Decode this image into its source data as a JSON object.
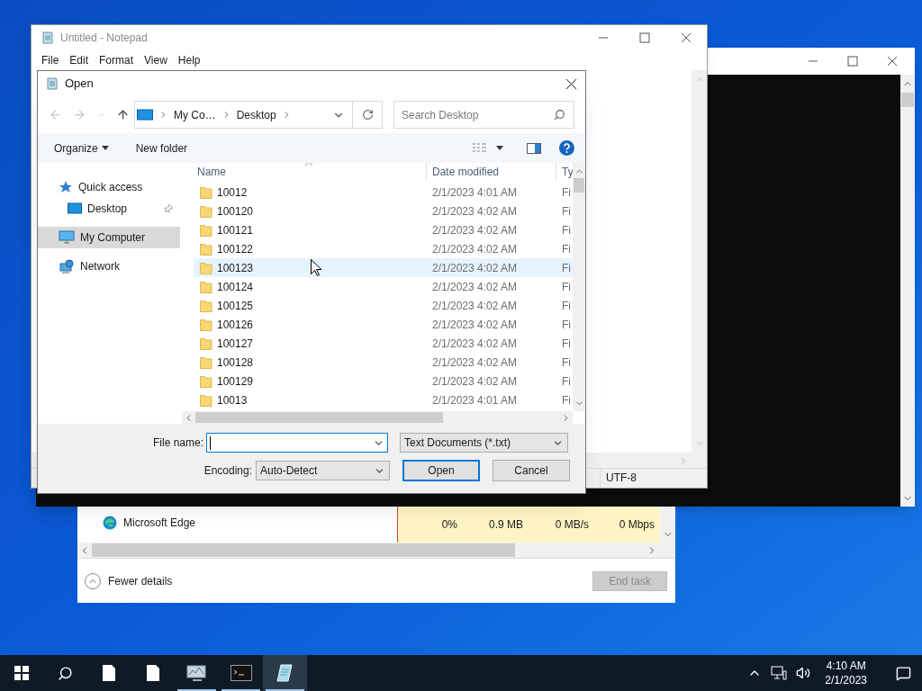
{
  "task_manager": {
    "process": {
      "name": "Microsoft Edge",
      "cells": [
        "0%",
        "0.9 MB",
        "0 MB/s",
        "0 Mbps"
      ]
    },
    "details_toggle": "Fewer details",
    "end_task": {
      "label": "End task",
      "disabled": true
    }
  },
  "notepad": {
    "title": "Untitled - Notepad",
    "menu": [
      "File",
      "Edit",
      "Format",
      "View",
      "Help"
    ],
    "status_bar": [
      "UTF-8"
    ]
  },
  "open_dialog": {
    "title": "Open",
    "breadcrumb": [
      "My Co…",
      "Desktop"
    ],
    "search": {
      "placeholder": "Search Desktop"
    },
    "toolbar": [
      "Organize",
      "New folder"
    ],
    "nav": [
      {
        "label": "Quick access",
        "kind": "star",
        "selected": false,
        "children": [
          {
            "label": "Desktop",
            "kind": "desktop",
            "selected": false,
            "pinned": true
          }
        ]
      },
      {
        "label": "My Computer",
        "kind": "computer",
        "selected": true
      },
      {
        "label": "Network",
        "kind": "network",
        "selected": false
      }
    ],
    "columns": [
      "Name",
      "Date modified",
      "Ty"
    ],
    "rows": [
      {
        "name": "10012",
        "date": "2/1/2023 4:01 AM",
        "type": "Fi",
        "hovered": false
      },
      {
        "name": "100120",
        "date": "2/1/2023 4:02 AM",
        "type": "Fi",
        "hovered": false
      },
      {
        "name": "100121",
        "date": "2/1/2023 4:02 AM",
        "type": "Fi",
        "hovered": false
      },
      {
        "name": "100122",
        "date": "2/1/2023 4:02 AM",
        "type": "Fi",
        "hovered": false
      },
      {
        "name": "100123",
        "date": "2/1/2023 4:02 AM",
        "type": "Fi",
        "hovered": true
      },
      {
        "name": "100124",
        "date": "2/1/2023 4:02 AM",
        "type": "Fi",
        "hovered": false
      },
      {
        "name": "100125",
        "date": "2/1/2023 4:02 AM",
        "type": "Fi",
        "hovered": false
      },
      {
        "name": "100126",
        "date": "2/1/2023 4:02 AM",
        "type": "Fi",
        "hovered": false
      },
      {
        "name": "100127",
        "date": "2/1/2023 4:02 AM",
        "type": "Fi",
        "hovered": false
      },
      {
        "name": "100128",
        "date": "2/1/2023 4:02 AM",
        "type": "Fi",
        "hovered": false
      },
      {
        "name": "100129",
        "date": "2/1/2023 4:02 AM",
        "type": "Fi",
        "hovered": false
      },
      {
        "name": "10013",
        "date": "2/1/2023 4:01 AM",
        "type": "Fi",
        "hovered": false
      }
    ],
    "file_name": {
      "label": "File name:"
    },
    "file_type": "Text Documents (*.txt)",
    "encoding": {
      "label": "Encoding:",
      "value": "Auto-Detect"
    },
    "buttons": [
      "Open",
      "Cancel"
    ]
  },
  "taskbar": {
    "apps": [
      {
        "kind": "document",
        "running": false,
        "active": false
      },
      {
        "kind": "document",
        "running": false,
        "active": false
      },
      {
        "kind": "monitor",
        "running": true,
        "active": false
      },
      {
        "kind": "console",
        "running": true,
        "active": false
      },
      {
        "kind": "notepad",
        "running": true,
        "active": true
      }
    ],
    "clock": {
      "time": "4:10 AM",
      "date": "2/1/2023"
    }
  }
}
